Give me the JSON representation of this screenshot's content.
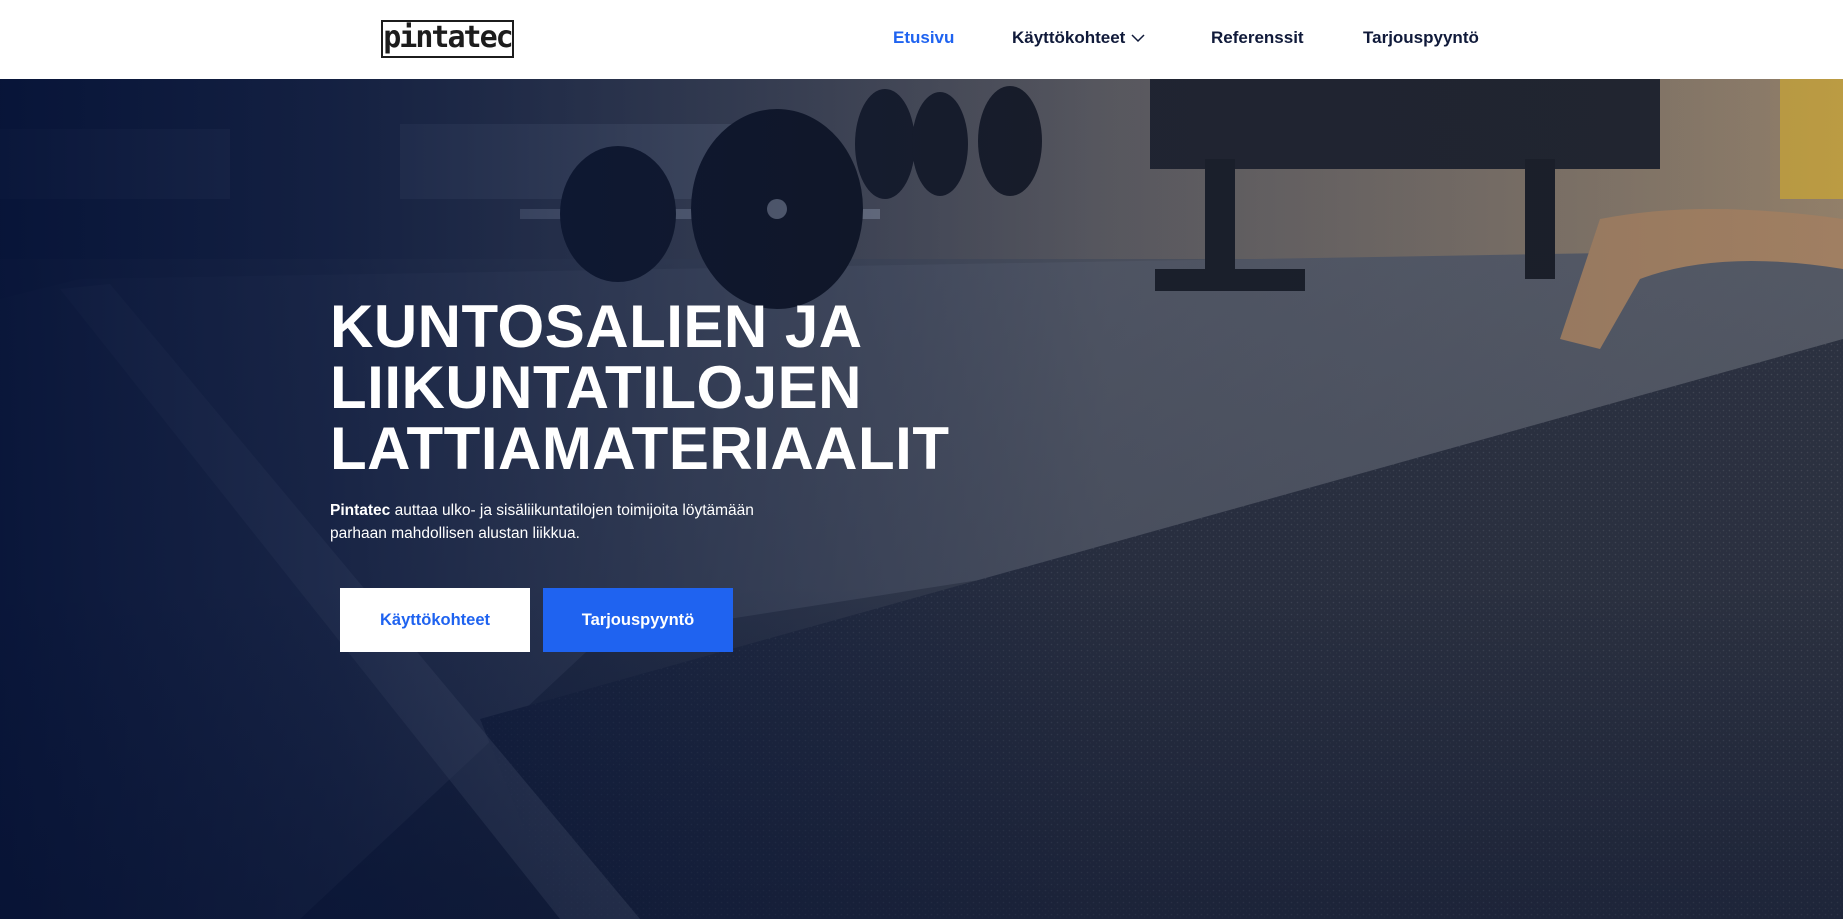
{
  "header": {
    "logo_text": "pintatec",
    "nav": [
      {
        "label": "Etusivu",
        "active": true
      },
      {
        "label": "Käyttökohteet",
        "has_dropdown": true
      },
      {
        "label": "Referenssit"
      },
      {
        "label": "Tarjouspyyntö"
      }
    ]
  },
  "hero": {
    "title_lines": [
      "KUNTOSALIEN JA",
      "LIIKUNTATILOJEN",
      "LATTIAMATERIAALIT"
    ],
    "desc_brand": "Pintatec",
    "desc_rest": " auttaa ulko- ja sisäliikuntatilojen toimijoita löytämään parhaan mahdollisen alustan liikkua.",
    "buttons": {
      "primary_outline": "Käyttökohteet",
      "primary": "Tarjouspyyntö"
    }
  },
  "colors": {
    "accent": "#1f63f0",
    "nav_text": "#101a3a",
    "overlay": "#051237"
  }
}
